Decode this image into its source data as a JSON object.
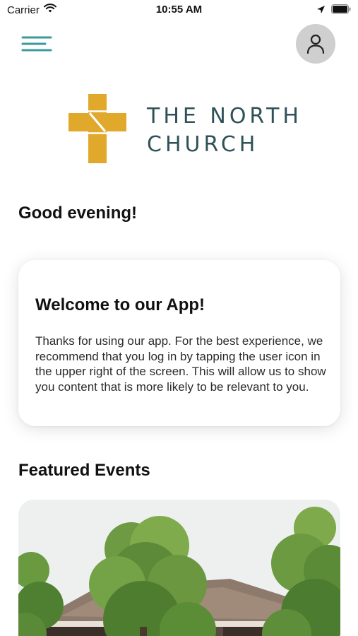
{
  "status_bar": {
    "carrier": "Carrier",
    "time": "10:55 AM"
  },
  "header": {
    "menu_icon": "hamburger-menu-icon",
    "profile_icon": "user-icon"
  },
  "logo": {
    "line1": "THE NORTH",
    "line2": "CHURCH",
    "brand_gold": "#e0a92c",
    "brand_teal": "#2f5258"
  },
  "greeting": "Good evening!",
  "welcome_card": {
    "title": "Welcome to our App!",
    "body": "Thanks for using our app. For the best experience, we recommend that you log in by tapping the user icon in the upper right of the screen. This will allow us to show you content that is more likely to be relevant to you."
  },
  "featured_events": {
    "title": "Featured Events"
  },
  "colors": {
    "accent": "#3c9a9a",
    "avatar_bg": "#cfcfcf"
  }
}
